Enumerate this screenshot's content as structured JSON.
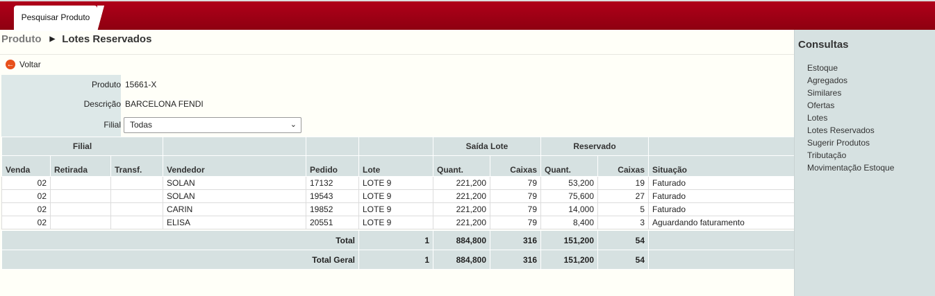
{
  "tabs": [
    {
      "label": "Pesquisar Produto"
    }
  ],
  "breadcrumb": {
    "link": "Produto",
    "current": "Lotes Reservados"
  },
  "back_label": "Voltar",
  "form": {
    "produto_label": "Produto",
    "produto_value": "15661-X",
    "descricao_label": "Descrição",
    "descricao_value": "BARCELONA FENDI",
    "filial_label": "Filial",
    "filial_selected": "Todas"
  },
  "table": {
    "groups": {
      "filial": "Filial",
      "saida_lote": "Saída Lote",
      "reservado": "Reservado"
    },
    "headers": {
      "venda": "Venda",
      "retirada": "Retirada",
      "transf": "Transf.",
      "vendedor": "Vendedor",
      "pedido": "Pedido",
      "lote": "Lote",
      "quant": "Quant.",
      "caixas": "Caixas",
      "quant2": "Quant.",
      "caixas2": "Caixas",
      "situacao": "Situação"
    },
    "rows": [
      {
        "venda": "02",
        "retirada": "",
        "transf": "",
        "vendedor": "SOLAN",
        "pedido": "17132",
        "lote": "LOTE 9",
        "saida_quant": "221,200",
        "saida_caixas": "79",
        "res_quant": "53,200",
        "res_caixas": "19",
        "situacao": "Faturado"
      },
      {
        "venda": "02",
        "retirada": "",
        "transf": "",
        "vendedor": "SOLAN",
        "pedido": "19543",
        "lote": "LOTE 9",
        "saida_quant": "221,200",
        "saida_caixas": "79",
        "res_quant": "75,600",
        "res_caixas": "27",
        "situacao": "Faturado"
      },
      {
        "venda": "02",
        "retirada": "",
        "transf": "",
        "vendedor": "CARIN",
        "pedido": "19852",
        "lote": "LOTE 9",
        "saida_quant": "221,200",
        "saida_caixas": "79",
        "res_quant": "14,000",
        "res_caixas": "5",
        "situacao": "Faturado"
      },
      {
        "venda": "02",
        "retirada": "",
        "transf": "",
        "vendedor": "ELISA",
        "pedido": "20551",
        "lote": "LOTE 9",
        "saida_quant": "221,200",
        "saida_caixas": "79",
        "res_quant": "8,400",
        "res_caixas": "3",
        "situacao": "Aguardando faturamento"
      }
    ],
    "total": {
      "label": "Total",
      "lote": "1",
      "saida_quant": "884,800",
      "saida_caixas": "316",
      "res_quant": "151,200",
      "res_caixas": "54"
    },
    "total_geral": {
      "label": "Total Geral",
      "lote": "1",
      "saida_quant": "884,800",
      "saida_caixas": "316",
      "res_quant": "151,200",
      "res_caixas": "54"
    }
  },
  "sidebar": {
    "title": "Consultas",
    "items": [
      {
        "label": "Estoque"
      },
      {
        "label": "Agregados"
      },
      {
        "label": "Similares"
      },
      {
        "label": "Ofertas"
      },
      {
        "label": "Lotes"
      },
      {
        "label": "Lotes Reservados"
      },
      {
        "label": "Sugerir Produtos"
      },
      {
        "label": "Tributação"
      },
      {
        "label": "Movimentação Estoque"
      }
    ]
  },
  "colors": {
    "brand": "#a00015",
    "panel": "#d6e1e1",
    "accent": "#e8501a"
  }
}
